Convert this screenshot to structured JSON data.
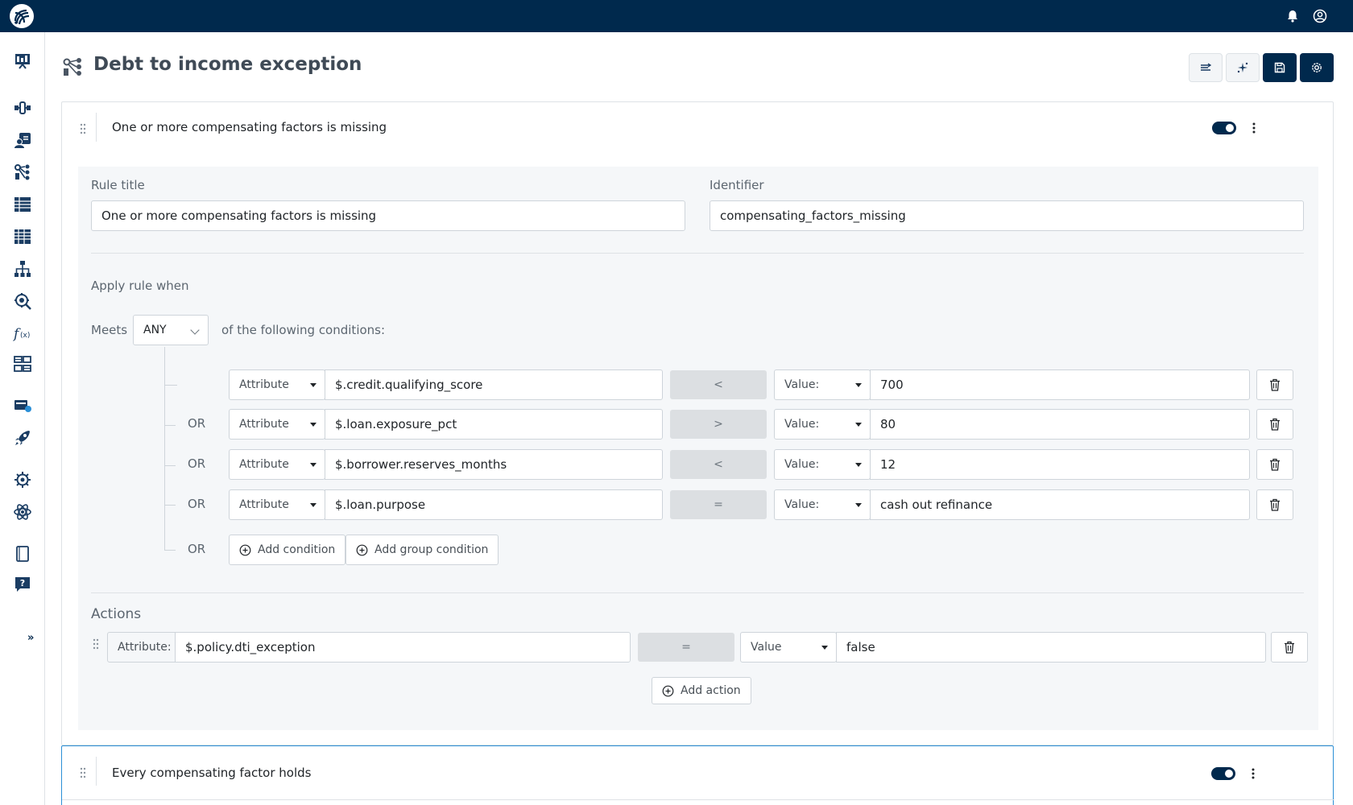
{
  "topbar": {
    "logo_icon": "espressif-logo-icon",
    "notification_icon": "bell-icon",
    "account_icon": "user-circle-icon"
  },
  "sidebar": {
    "items": [
      {
        "icon": "dashboard-icon"
      },
      {
        "icon": "workflow-icon"
      },
      {
        "icon": "agent-icon"
      },
      {
        "icon": "decision-tree-icon"
      },
      {
        "icon": "data-table-icon"
      },
      {
        "icon": "list-table-icon"
      },
      {
        "icon": "hierarchy-icon"
      },
      {
        "icon": "gear-search-icon"
      },
      {
        "icon": "function-icon"
      },
      {
        "icon": "grid-table-icon"
      },
      {
        "icon": "integration-icon"
      },
      {
        "icon": "rocket-icon"
      },
      {
        "icon": "virus-icon"
      },
      {
        "icon": "atom-icon"
      },
      {
        "icon": "document-icon"
      },
      {
        "icon": "help-icon"
      }
    ],
    "expand_label": "»"
  },
  "header": {
    "title": "Debt to income exception",
    "buttons": [
      {
        "icon": "filter-lines-icon"
      },
      {
        "icon": "sparkle-icon"
      },
      {
        "icon": "save-icon"
      },
      {
        "icon": "settings-icon"
      }
    ]
  },
  "rules": [
    {
      "title": "One or more compensating factors is missing",
      "enabled": true,
      "form": {
        "title_label": "Rule title",
        "title_value": "One or more compensating factors is missing",
        "identifier_label": "Identifier",
        "identifier_value": "compensating_factors_missing",
        "apply_label": "Apply rule when",
        "meets_label": "Meets",
        "meets_value": "ANY",
        "following_label": "of the following conditions:",
        "conditions": [
          {
            "connector": "",
            "type": "Attribute",
            "path": "$.credit.qualifying_score",
            "operator": "<",
            "value_type": "Value:",
            "value": "700"
          },
          {
            "connector": "OR",
            "type": "Attribute",
            "path": "$.loan.exposure_pct",
            "operator": ">",
            "value_type": "Value:",
            "value": "80"
          },
          {
            "connector": "OR",
            "type": "Attribute",
            "path": "$.borrower.reserves_months",
            "operator": "<",
            "value_type": "Value:",
            "value": "12"
          },
          {
            "connector": "OR",
            "type": "Attribute",
            "path": "$.loan.purpose",
            "operator": "=",
            "value_type": "Value:",
            "value": "cash out refinance"
          }
        ],
        "footer_connector": "OR",
        "add_condition_label": "Add condition",
        "add_group_label": "Add group condition",
        "actions_label": "Actions",
        "actions": [
          {
            "attr_label": "Attribute:",
            "path": "$.policy.dti_exception",
            "operator": "=",
            "value_type": "Value",
            "value": "false"
          }
        ],
        "add_action_label": "Add action"
      }
    },
    {
      "title": "Every compensating factor holds",
      "enabled": true
    }
  ]
}
